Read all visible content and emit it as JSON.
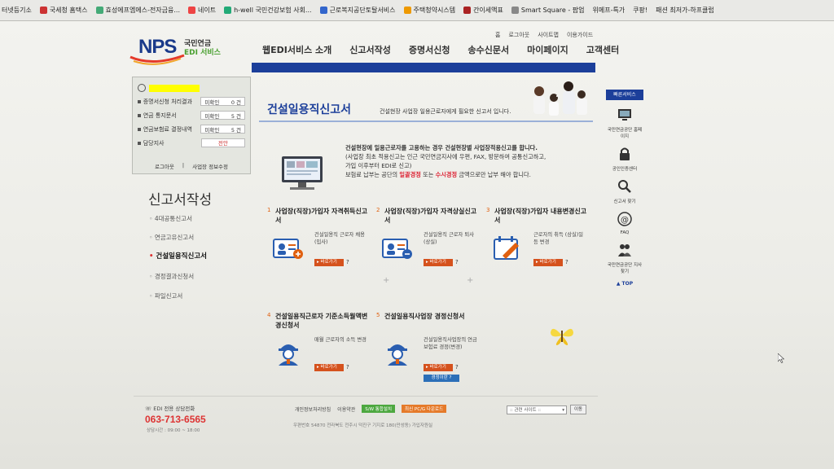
{
  "bookmarks": [
    "터넷등기소",
    "국세청 홈택스",
    "효성에프엠에스-전자금융...",
    "네이트",
    "h-well 국민건강보험 사회...",
    "근로복지공단토탈서비스",
    "주택청약시스템",
    "간이세액표",
    "Smart Square - 팝업",
    "위메프-특가",
    "쿠팡!",
    "패션 최저가-하프클럽"
  ],
  "logo": {
    "nps": "NPS",
    "line1": "국민연금",
    "line2": "EDI 서비스"
  },
  "util_links": [
    "홈",
    "로그아웃",
    "사이트맵",
    "이용가이드"
  ],
  "gnb": [
    "웹EDI서비스 소개",
    "신고서작성",
    "증명서신청",
    "송수신문서",
    "마이페이지",
    "고객센터"
  ],
  "login_box": {
    "rows": [
      {
        "label": "증명서신청 처리결과",
        "status": "미확인",
        "count": "0 건"
      },
      {
        "label": "연금 통지문서",
        "status": "미확인",
        "count": "5 건"
      },
      {
        "label": "연금보험료 결정내역",
        "status": "미확인",
        "count": "5 건"
      }
    ],
    "branch_label": "담당지사",
    "branch_value": "전안",
    "logout": "로그아웃",
    "edit": "사업장 정보수정"
  },
  "lnb": {
    "title": "신고서작성",
    "items": [
      "4대공통신고서",
      "연금고유신고서",
      "건설일용직신고서",
      "경정결과신청서",
      "파일신고서"
    ]
  },
  "hero": {
    "title": "건설일용직신고서",
    "desc": "건설현장 사업장 일용근로자에게 필요한 신고서 입니다."
  },
  "intro": {
    "line1a": "건설현장에 일용근로자를 고용하는 경우 건설현장별 사업장적용신고를 합니다.",
    "line2": "(사업장 최초 적용신고는 인근 국민연금지사에 우편, FAX, 방문하여 공통신고하고,",
    "line3": "가입 이후부터 EDI로 신고)",
    "line4a": "보험료 납부는 공단의 ",
    "line4b": "일괄경정",
    "line4c": " 또는 ",
    "line4d": "수시경정",
    "line4e": " 금액으로만 납부 해야 합니다."
  },
  "cards": [
    {
      "num": "1",
      "title": "사업장(직장)가입자 자격취득신고서",
      "desc": "건설일용직 근로자 채용 (입사)",
      "go": "▸ 바로가기",
      "q": "?"
    },
    {
      "num": "2",
      "title": "사업장(직장)가입자 자격상실신고서",
      "desc": "건설일용직 근로자 퇴사 (상실)",
      "go": "▸ 바로가기",
      "q": "?"
    },
    {
      "num": "3",
      "title": "사업장(직장)가입자 내용변경신고서",
      "desc": "근로자의 취득 (상실)일 등 변경",
      "go": "▸ 바로가기",
      "q": "?"
    },
    {
      "num": "4",
      "title": "건설일용직근로자 기준소득월액변경신청서",
      "desc": "매월 근로자의 소득 변경",
      "go": "▸ 바로가기",
      "q": "?"
    },
    {
      "num": "5",
      "title": "건설일용직사업장 경정신청서",
      "desc": "건설일용직사업장의 연금보험료 경정(변경)",
      "go": "▸ 바로가기",
      "q": "?",
      "extra": "경정이란 ?"
    }
  ],
  "quick": {
    "head": "빠른서비스",
    "items": [
      "국민연금공단 홈페이지",
      "공인인증센터",
      "신고서 찾기",
      "FAQ",
      "국민연금공단 지사찾기"
    ],
    "top": "▲ TOP"
  },
  "footer": {
    "call": "EDI 전용 상담전화",
    "phone": "063-713-6565",
    "hours": "상담시간 : 09:00 ~ 18:00",
    "links": [
      "개인정보처리방침",
      "이용약관"
    ],
    "badge1": "S/W 통합설치",
    "badge2": "최신 PC/G 다운로드",
    "select": ":: 관련 사이트 ::",
    "go": "이동",
    "addr": "우편번호 54870 전라북도 전주시 덕진구 기지로 180(만성동) 가입자원실"
  },
  "colors": {
    "brand": "#1c3f9a",
    "accent": "#d5521d",
    "highlight": "#ffff00"
  }
}
